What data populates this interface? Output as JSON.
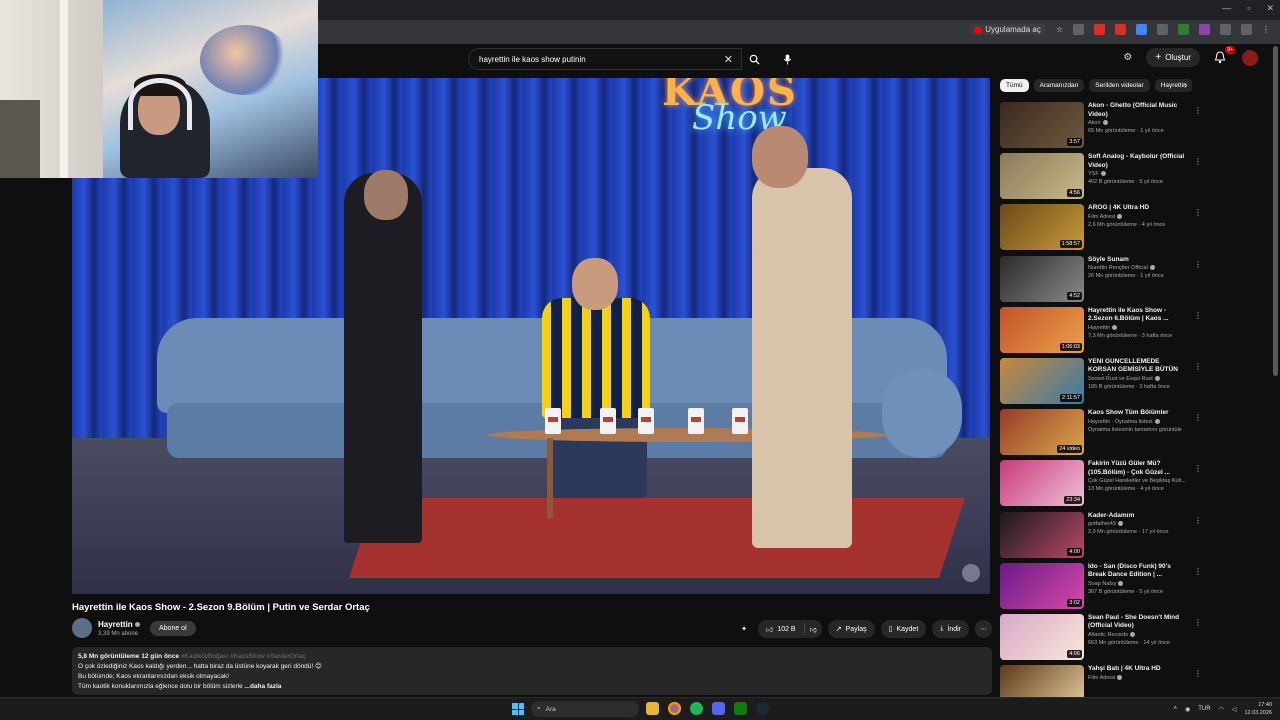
{
  "browser": {
    "open_in_app": "Uygulamada aç"
  },
  "header": {
    "search_value": "hayrettin ile kaos show putinin",
    "create_label": "Oluştur",
    "notification_count": "9+"
  },
  "video": {
    "neon_title": "KAOS",
    "neon_sub": "Show",
    "title": "Hayrettin ile Kaos Show - 2.Sezon 9.Bölüm | Putin ve Serdar Ortaç",
    "channel": "Hayrettin",
    "subscribers": "3,39 Mn abone",
    "subscribe_label": "Abone ol",
    "likes": "102 B",
    "share_label": "Paylaş",
    "save_label": "Kaydet",
    "download_label": "İndir"
  },
  "description": {
    "meta": "5,8 Mn görüntüleme  12 gün önce",
    "tags": "#KadıköyBoğası #KaosShow #SerdarOrtaç",
    "line1": "O çok özlediğiniz Kaos kaldığı yerden... hatta biraz da üstüne koyarak geri döndü! 😊",
    "line2": "Bu bölümde; Kaos ekranlarınızdan eksik olmayacak!",
    "line3": "Tüm kaotik konuklarımızla eğlence dolu bir bölüm sizlerle ",
    "more": "...daha fazla"
  },
  "chips": [
    "Tümü",
    "Aramanızdan",
    "Serilden videolar",
    "Hayrettin"
  ],
  "recommendations": [
    {
      "title": "Akon - Ghetto (Official Music Video)",
      "channel": "Akon",
      "meta": "65 Mn görüntüleme · 1 yıl önce",
      "duration": "3:57",
      "c1": "#3a2a1e",
      "c2": "#6d5a3f"
    },
    {
      "title": "Soft Analog - Kaybolur (Official Video)",
      "channel": "YSF",
      "meta": "402 B görüntüleme · 5 yıl önce",
      "duration": "4:56",
      "c1": "#8a7a5a",
      "c2": "#c9b98a"
    },
    {
      "title": "AROG | 4K Ultra HD",
      "channel": "Film Adresi",
      "meta": "2,6 Mn görüntüleme · 4 yıl önce",
      "duration": "1:58:57",
      "c1": "#6b4a1a",
      "c2": "#c99a3a"
    },
    {
      "title": "Söyle Sunam",
      "channel": "Nurettin Rençber Official",
      "meta": "26 Mn görüntüleme · 1 yıl önce",
      "duration": "4:52",
      "c1": "#2a2a2a",
      "c2": "#8a8a8a"
    },
    {
      "title": "Hayrettin ile Kaos Show - 2.Sezon 6.Bölüm | Kaos ...",
      "channel": "Hayrettin",
      "meta": "7,3 Mn görüntüleme · 3 hafta önce",
      "duration": "1:06:03",
      "c1": "#c4522a",
      "c2": "#e9a24a"
    },
    {
      "title": "YENİ GÜNCELLEMEDE KORSAN GEMİSİYLE BÜTÜN DENİZİ EL...",
      "channel": "Sessel Rust ve Esqui Rust",
      "meta": "185 B görüntüleme · 3 hafta önce",
      "duration": "2:11:57",
      "c1": "#c98a3a",
      "c2": "#3a7aa8"
    },
    {
      "title": "Kaos Show Tüm Bölümler",
      "channel": "Hayrettin · Oynatma listesi",
      "meta": "Oynatma listesinin tamamını görüntüle",
      "duration": "24 video",
      "c1": "#9a3a2a",
      "c2": "#d8a84a"
    },
    {
      "title": "Fakirin Yüzü Güler Mü? (105.Bölüm) - Çok Güzel ...",
      "channel": "Çok Güzel Hareketler ve Beşiktaş Kült...",
      "meta": "13 Mn görüntüleme · 4 yıl önce",
      "duration": "23:34",
      "c1": "#c83a7a",
      "c2": "#f0c0d8"
    },
    {
      "title": "Kader-Adamım",
      "channel": "gotfather43",
      "meta": "2,9 Mn görüntüleme · 17 yıl önce",
      "duration": "4:00",
      "c1": "#1a1a1a",
      "c2": "#b84a6a"
    },
    {
      "title": "İdo - San (Disco Funk) 90's Break Dance Edition | ...",
      "channel": "Soap Natsy",
      "meta": "367 B görüntüleme · 5 yıl önce",
      "duration": "3:02",
      "c1": "#6a1a8a",
      "c2": "#d84aa8"
    },
    {
      "title": "Sean Paul - She Doesn't Mind (Official Video)",
      "channel": "Atlantic Records",
      "meta": "663 Mn görüntüleme · 14 yıl önce",
      "duration": "4:06",
      "c1": "#d8a8c8",
      "c2": "#f8e8d8"
    },
    {
      "title": "Yahşi Batı | 4K Ultra HD",
      "channel": "Film Adresi",
      "meta": "",
      "duration": "",
      "c1": "#5a3a1a",
      "c2": "#e8d0a0"
    }
  ],
  "taskbar": {
    "search_placeholder": "Ara",
    "language": "TUR",
    "time": "17:40",
    "date": "12.03.2026"
  }
}
